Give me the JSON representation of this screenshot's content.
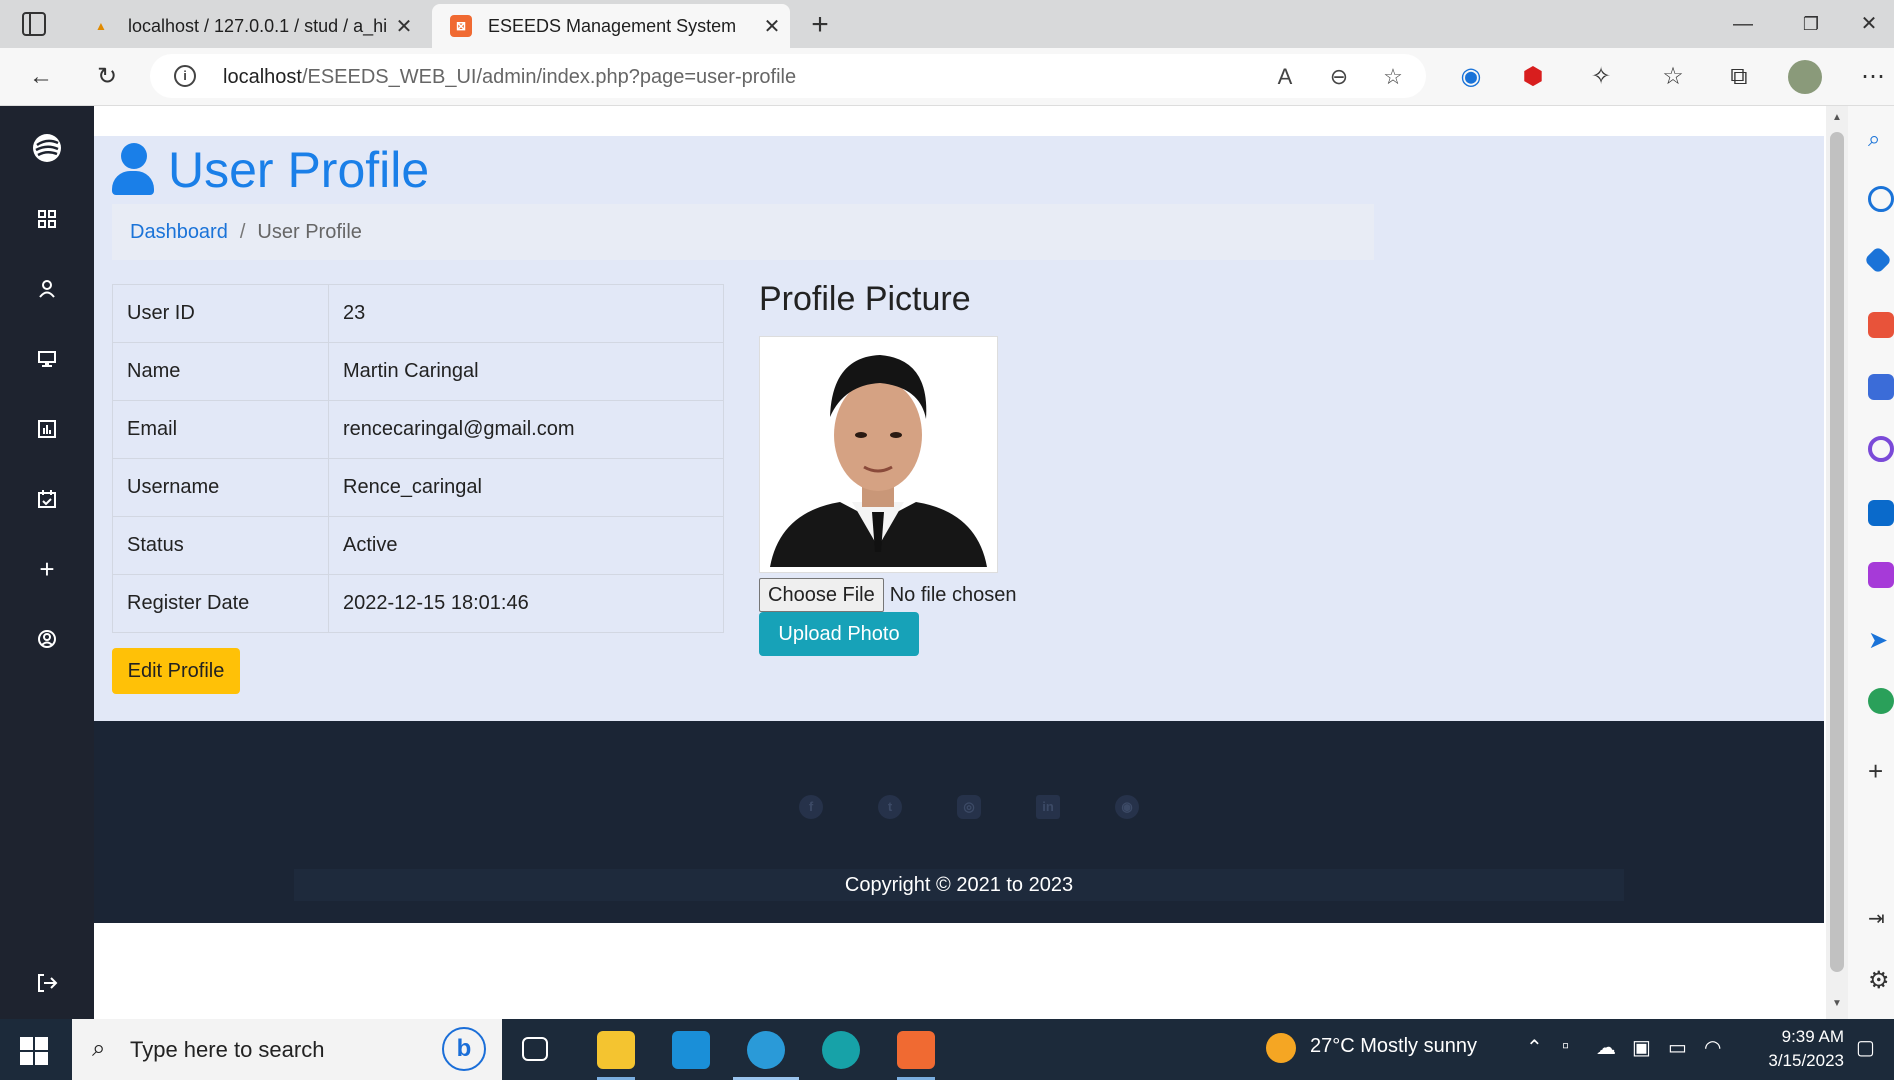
{
  "browser": {
    "tabs": [
      {
        "title": "localhost / 127.0.0.1 / stud / a_hi",
        "favicon": "PMA",
        "active": false
      },
      {
        "title": "ESEEDS Management System",
        "favicon": "xampp-icon",
        "active": true
      }
    ],
    "address": {
      "host": "localhost",
      "path": "/ESEEDS_WEB_UI/admin/index.php?page=user-profile"
    }
  },
  "page": {
    "title": "User Profile",
    "breadcrumb": {
      "home": "Dashboard",
      "current": "User Profile"
    },
    "profile_rows": [
      {
        "label": "User ID",
        "value": "23"
      },
      {
        "label": "Name",
        "value": "Martin Caringal"
      },
      {
        "label": "Email",
        "value": "rencecaringal@gmail.com"
      },
      {
        "label": "Username",
        "value": "Rence_caringal"
      },
      {
        "label": "Status",
        "value": "Active"
      },
      {
        "label": "Register Date",
        "value": "2022-12-15 18:01:46"
      }
    ],
    "edit_button": "Edit Profile",
    "picture_title": "Profile Picture",
    "file_button": "Choose File",
    "file_status": "No file chosen",
    "upload_button": "Upload Photo",
    "footer": {
      "social": [
        "facebook-icon",
        "twitter-icon",
        "instagram-icon",
        "linkedin-icon",
        "github-icon"
      ],
      "copyright": "Copyright © 2021 to 2023"
    }
  },
  "sidebar": [
    "logo-icon",
    "dashboard-icon",
    "user-icon",
    "monitor-icon",
    "chart-icon",
    "calendar-check-icon",
    "plus-icon",
    "user-circle-icon",
    "logout-icon"
  ],
  "taskbar": {
    "search_placeholder": "Type here to search",
    "weather": "27°C  Mostly sunny",
    "time": "9:39 AM",
    "date": "3/15/2023"
  },
  "colors": {
    "accent": "#1a7fe8",
    "sidebar": "#1e232f",
    "footer": "#1b2535",
    "edit": "#ffc107",
    "upload": "#17a2b8"
  }
}
